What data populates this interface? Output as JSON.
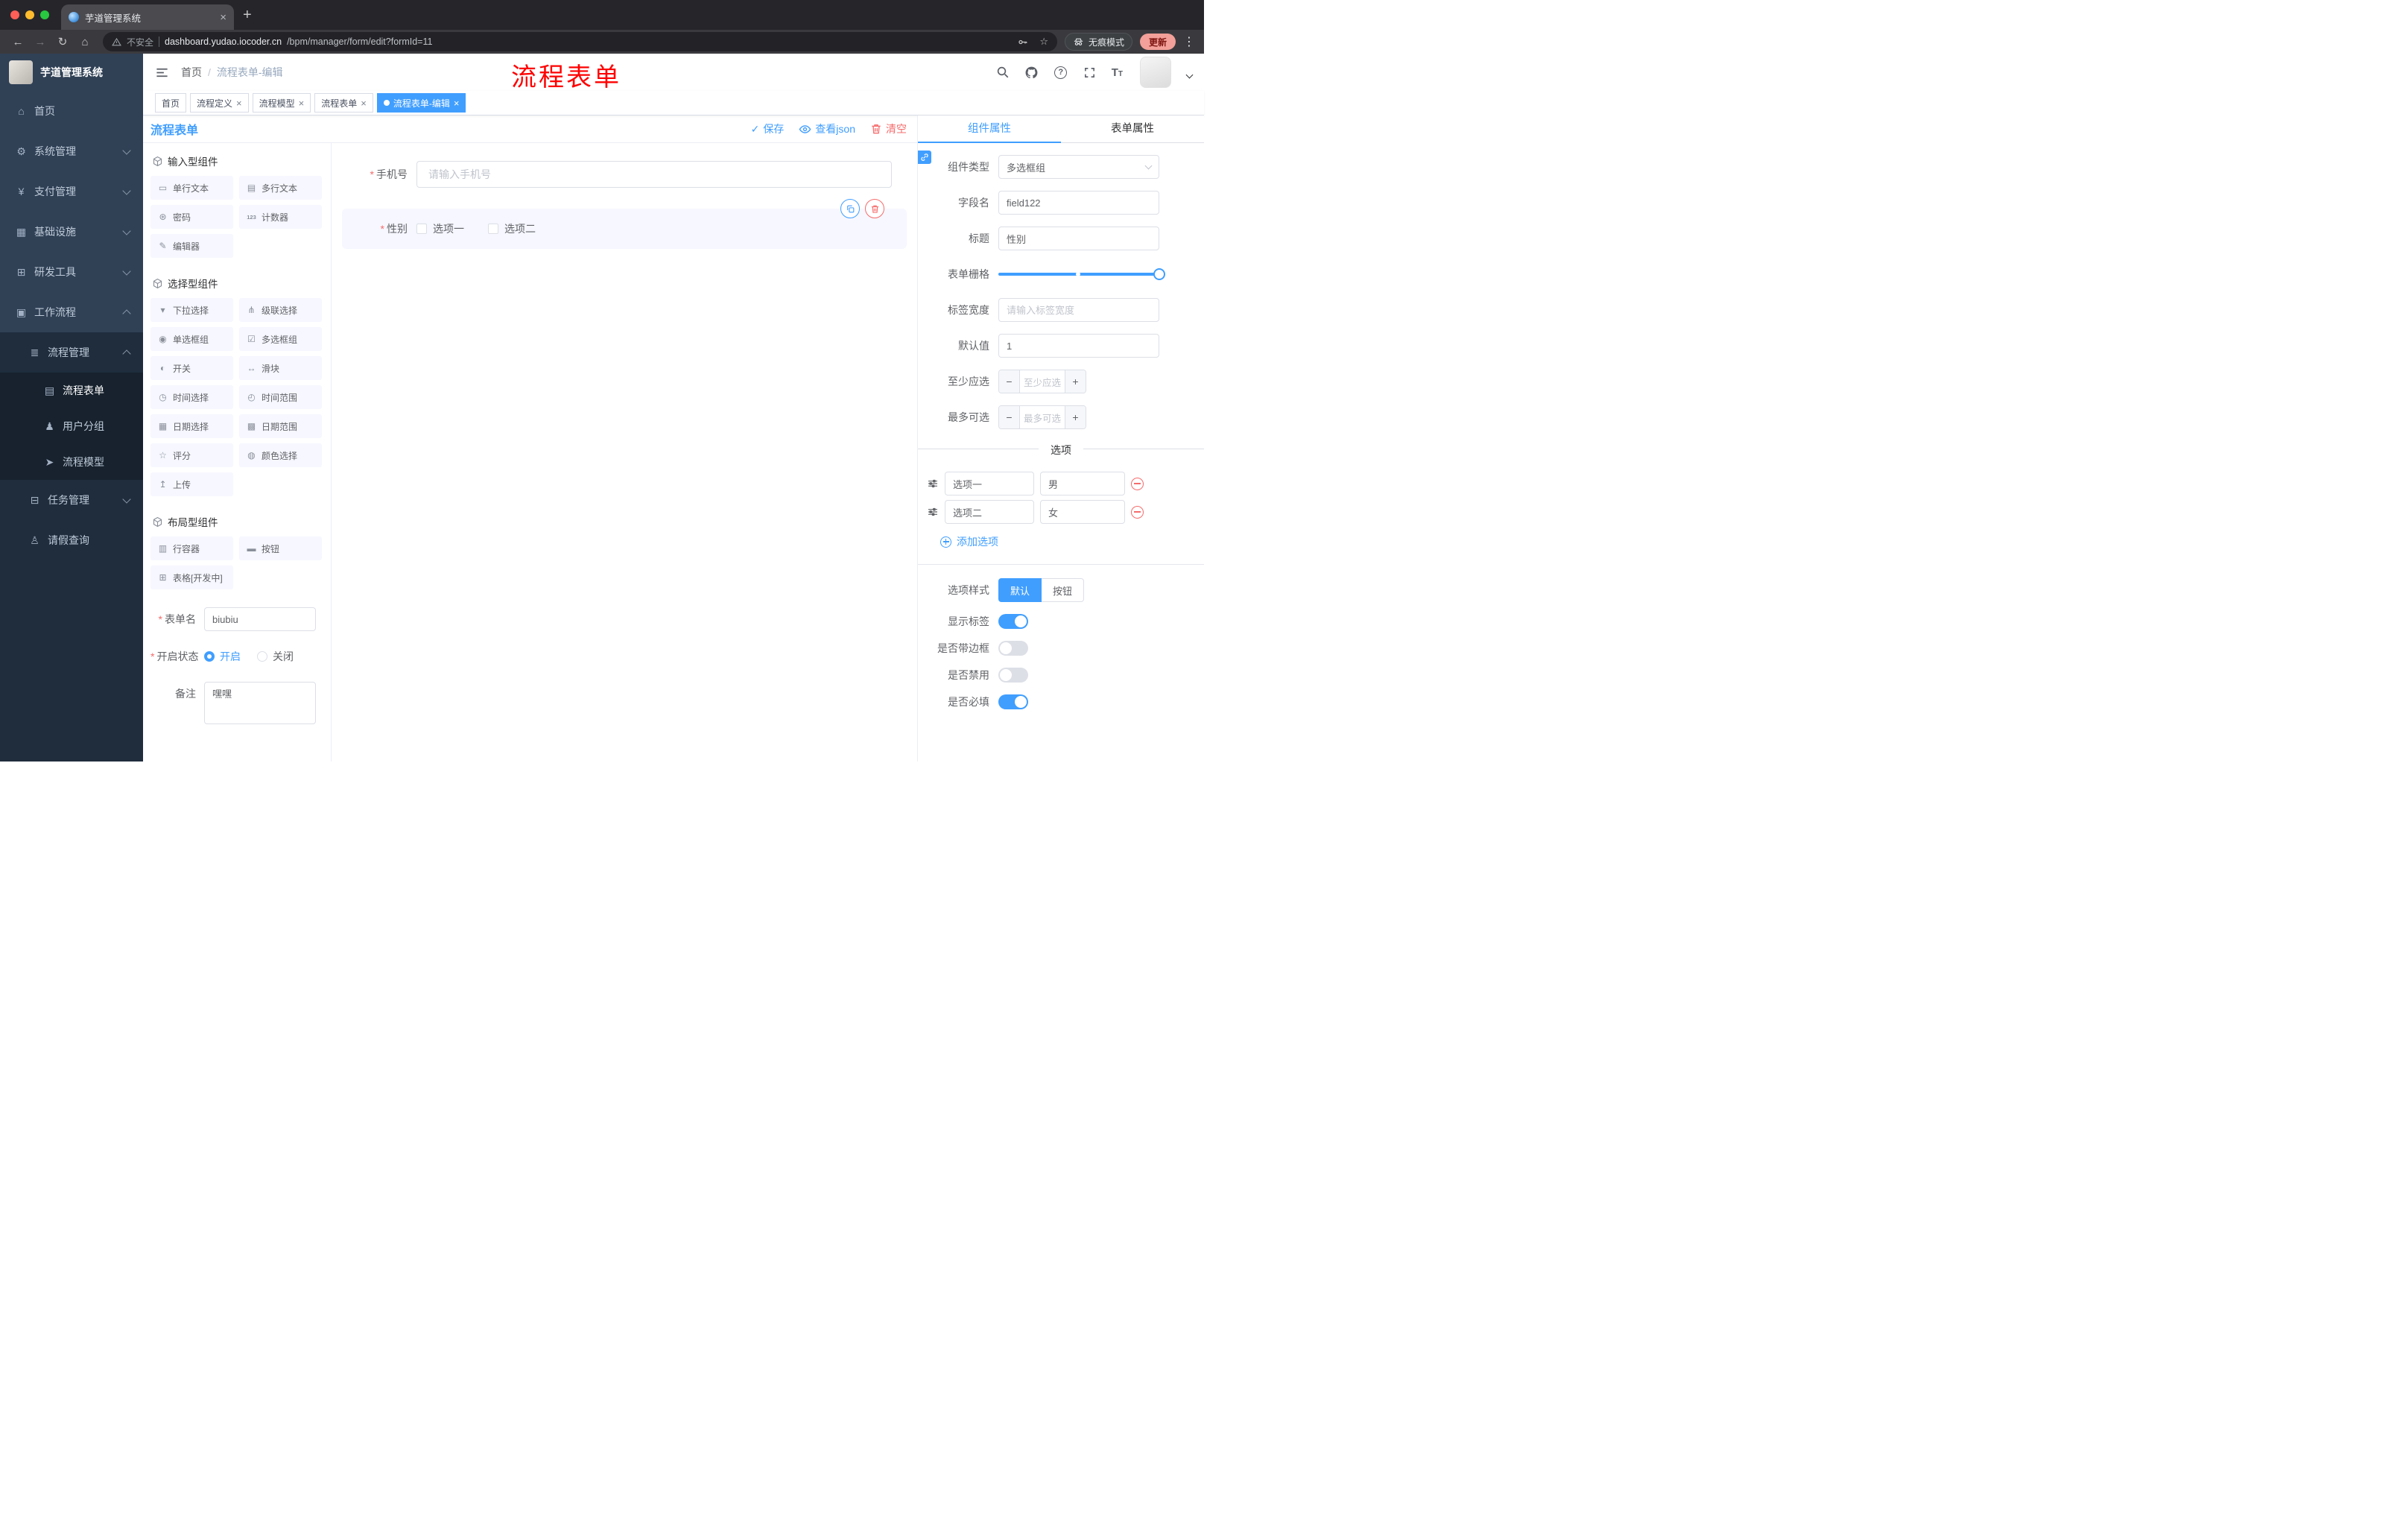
{
  "browser": {
    "tab_title": "芋道管理系统",
    "security_label": "不安全",
    "url_host": "dashboard.yudao.iocoder.cn",
    "url_path": "/bpm/manager/form/edit?formId=11",
    "incognito_label": "无痕模式",
    "update_label": "更新"
  },
  "sidebar": {
    "logo_title": "芋道管理系统",
    "items": [
      {
        "label": "首页"
      },
      {
        "label": "系统管理"
      },
      {
        "label": "支付管理"
      },
      {
        "label": "基础设施"
      },
      {
        "label": "研发工具"
      },
      {
        "label": "工作流程"
      },
      {
        "label": "流程管理"
      },
      {
        "label": "流程表单",
        "active": true
      },
      {
        "label": "用户分组"
      },
      {
        "label": "流程模型"
      },
      {
        "label": "任务管理"
      },
      {
        "label": "请假查询"
      }
    ]
  },
  "header": {
    "breadcrumb_home": "首页",
    "breadcrumb_separator": "/",
    "breadcrumb_current": "流程表单-编辑",
    "annotation": "流程表单"
  },
  "tags": [
    {
      "label": "首页",
      "active": false
    },
    {
      "label": "流程定义",
      "active": false
    },
    {
      "label": "流程模型",
      "active": false
    },
    {
      "label": "流程表单",
      "active": false
    },
    {
      "label": "流程表单-编辑",
      "active": true
    }
  ],
  "designer": {
    "panel_title": "流程表单",
    "save_label": "保存",
    "view_json_label": "查看json",
    "clear_label": "清空",
    "groups": [
      {
        "title": "输入型组件",
        "items": [
          "单行文本",
          "多行文本",
          "密码",
          "计数器",
          "编辑器"
        ]
      },
      {
        "title": "选择型组件",
        "items": [
          "下拉选择",
          "级联选择",
          "单选框组",
          "多选框组",
          "开关",
          "滑块",
          "时间选择",
          "时间范围",
          "日期选择",
          "日期范围",
          "评分",
          "颜色选择",
          "上传"
        ]
      },
      {
        "title": "布局型组件",
        "items": [
          "行容器",
          "按钮",
          "表格[开发中]"
        ]
      }
    ],
    "settings": {
      "name_label": "表单名",
      "name_value": "biubiu",
      "status_label": "开启状态",
      "status_on": "开启",
      "status_on_selected": true,
      "status_off": "关闭",
      "status_off_selected": false,
      "remark_label": "备注",
      "remark_value": "嘿嘿"
    }
  },
  "canvas": {
    "phone_label": "手机号",
    "phone_placeholder": "请输入手机号",
    "gender_label": "性别",
    "gender_options": [
      "选项一",
      "选项二"
    ]
  },
  "props": {
    "tab_component": "组件属性",
    "tab_form": "表单属性",
    "component_type_label": "组件类型",
    "component_type_value": "多选框组",
    "field_label": "字段名",
    "field_value": "field122",
    "title_label": "标题",
    "title_value": "性别",
    "grid_label": "表单栅格",
    "grid_value_percent": 100,
    "grid_mark_percent": 48,
    "label_width_label": "标签宽度",
    "label_width_placeholder": "请输入标签宽度",
    "default_label": "默认值",
    "default_value": "1",
    "min_label": "至少应选",
    "min_placeholder": "至少应选",
    "max_label": "最多可选",
    "max_placeholder": "最多可选",
    "options_title": "选项",
    "options": [
      {
        "label": "选项一",
        "value": "男"
      },
      {
        "label": "选项二",
        "value": "女"
      }
    ],
    "add_option_label": "添加选项",
    "style_label": "选项样式",
    "style_default": "默认",
    "style_default_active": true,
    "style_button": "按钮",
    "switch_rows": [
      {
        "label": "显示标签",
        "on": true
      },
      {
        "label": "是否带边框",
        "on": false
      },
      {
        "label": "是否禁用",
        "on": false
      },
      {
        "label": "是否必填",
        "on": true
      }
    ]
  },
  "icons": {
    "home": "⌂",
    "system": "⚙",
    "pay": "¥",
    "infra": "▦",
    "devtool": "⊞",
    "workflow": "▣",
    "process_mgmt": "≣",
    "process_form": "▤",
    "user_group": "♟",
    "process_model": "➤",
    "task_mgmt": "⊟",
    "leave_query": "♙",
    "comp_input": "▭",
    "comp_textarea": "▤",
    "comp_password": "⊛",
    "comp_counter": "123",
    "comp_editor": "✎",
    "comp_select": "▾",
    "comp_cascader": "⋔",
    "comp_radio": "◉",
    "comp_checkbox": "☑",
    "comp_switch": "◐",
    "comp_slider": "↔",
    "comp_time": "◷",
    "comp_time_range": "◴",
    "comp_date": "▦",
    "comp_date_range": "▩",
    "comp_rate": "☆",
    "comp_color": "◍",
    "comp_upload": "↥",
    "comp_row": "▥",
    "comp_button": "▬",
    "comp_table": "⊞",
    "back": "←",
    "forward": "→",
    "reload": "↻",
    "home_nav": "⌂",
    "star": "☆",
    "dots": "⋮",
    "check": "✓"
  },
  "colors": {
    "primary": "#409eff",
    "danger": "#f56c6c",
    "sidebar": "#304156",
    "annotation": "#fe0000"
  }
}
